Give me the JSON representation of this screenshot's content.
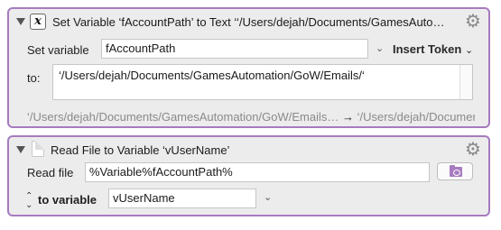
{
  "action1": {
    "title": "Set Variable ‘fAccountPath’ to Text ‘‘/Users/dejah/Documents/GamesAuto…",
    "title_icon": "x-variable-icon",
    "set_variable_label": "Set variable",
    "variable_value": "fAccountPath",
    "insert_token_label": "Insert Token",
    "to_label": "to:",
    "text_value": "‘/Users/dejah/Documents/GamesAutomation/GoW/Emails/‘",
    "preview_source": "‘/Users/dejah/Documents/GamesAutomation/GoW/Emails…",
    "preview_arrow": "→",
    "preview_result": "‘/Users/dejah/Documents/GamesAutomation/GoW/Emails/‘"
  },
  "action2": {
    "title": "Read File to Variable ‘vUserName’",
    "title_icon": "file-icon",
    "read_file_label": "Read file",
    "path_value": "%Variable%fAccountPath%",
    "to_variable_label": "to variable",
    "variable_value": "vUserName"
  },
  "colors": {
    "accent": "#a77bbf",
    "panel_bg": "#ececec"
  }
}
